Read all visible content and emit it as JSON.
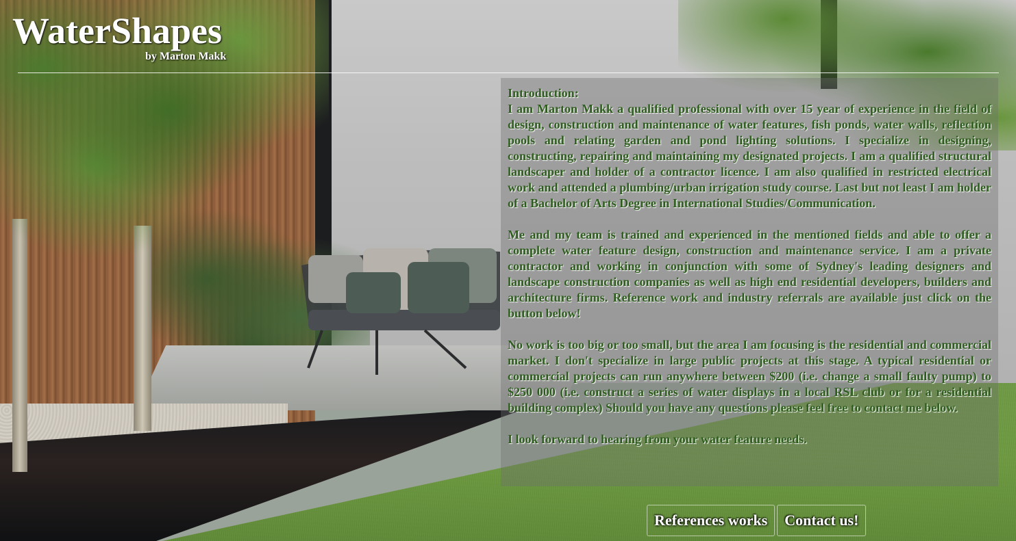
{
  "header": {
    "title": "WaterShapes",
    "subtitle": "by Marton Makk"
  },
  "intro": {
    "heading": "Introduction:",
    "paragraphs": [
      "I am Marton Makk a qualified professional with over 15 year of experience in the field of design, construction and maintenance of water features, fish ponds, water walls, reflection pools and relating garden and pond lighting solutions. I specialize in designing, constructing, repairing and maintaining my designated projects. I am a qualified structural landscaper and holder of a contractor licence. I am also qualified in restricted electrical work and attended a plumbing/urban irrigation study course. Last but not least I am holder of a Bachelor of Arts Degree in International Studies/Communication.",
      "Me and my team is trained and experienced in the mentioned fields and able to offer a complete water feature design, construction and maintenance service. I am a private contractor and working in conjunction with some of Sydney's leading designers and landscape construction companies as well as high end residential developers, builders and architecture firms. Reference work and industry referrals are available just click on the button below!",
      "No work is too big or too small, but the area I am focusing is the residential and commercial market. I don't specialize in large public projects at this stage. A typical residential or commercial projects can run anywhere between $200 (i.e. change a small faulty pump) to $250 000 (i.e. construct a series of water displays in a local RSL club or for a residential building complex) Should you have any questions please feel free to contact me below.",
      "I look forward to hearing from your water feature needs."
    ]
  },
  "buttons": {
    "references_label": "References works",
    "contact_label": "Contact us!"
  },
  "colors": {
    "text_green": "#2f5d1f",
    "header_white": "#ffffff",
    "panel_overlay": "rgba(110,110,110,0.38)"
  },
  "background": {
    "description_icon": "garden-photo"
  }
}
